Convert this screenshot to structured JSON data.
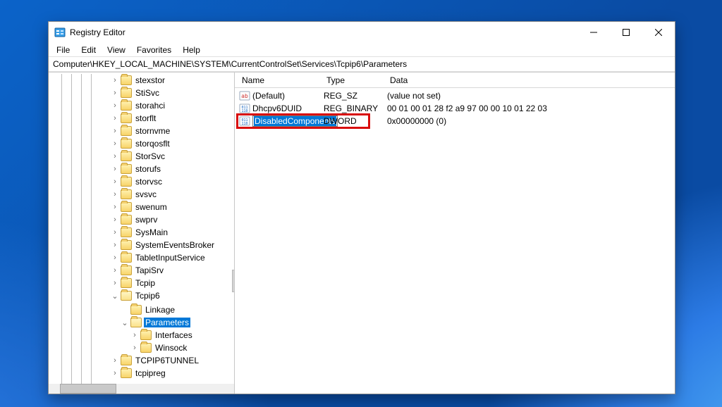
{
  "window": {
    "title": "Registry Editor",
    "menus": [
      "File",
      "Edit",
      "View",
      "Favorites",
      "Help"
    ],
    "address": "Computer\\HKEY_LOCAL_MACHINE\\SYSTEM\\CurrentControlSet\\Services\\Tcpip6\\Parameters"
  },
  "tree": [
    {
      "label": "stexstor",
      "depth": 0,
      "expander": ">"
    },
    {
      "label": "StiSvc",
      "depth": 0,
      "expander": ">"
    },
    {
      "label": "storahci",
      "depth": 0,
      "expander": ">"
    },
    {
      "label": "storflt",
      "depth": 0,
      "expander": ">"
    },
    {
      "label": "stornvme",
      "depth": 0,
      "expander": ">"
    },
    {
      "label": "storqosflt",
      "depth": 0,
      "expander": ">"
    },
    {
      "label": "StorSvc",
      "depth": 0,
      "expander": ">"
    },
    {
      "label": "storufs",
      "depth": 0,
      "expander": ">"
    },
    {
      "label": "storvsc",
      "depth": 0,
      "expander": ">"
    },
    {
      "label": "svsvc",
      "depth": 0,
      "expander": ">"
    },
    {
      "label": "swenum",
      "depth": 0,
      "expander": ">"
    },
    {
      "label": "swprv",
      "depth": 0,
      "expander": ">"
    },
    {
      "label": "SysMain",
      "depth": 0,
      "expander": ">"
    },
    {
      "label": "SystemEventsBroker",
      "depth": 0,
      "expander": ">"
    },
    {
      "label": "TabletInputService",
      "depth": 0,
      "expander": ">"
    },
    {
      "label": "TapiSrv",
      "depth": 0,
      "expander": ">"
    },
    {
      "label": "Tcpip",
      "depth": 0,
      "expander": ">"
    },
    {
      "label": "Tcpip6",
      "depth": 0,
      "expander": "v",
      "open": true
    },
    {
      "label": "Linkage",
      "depth": 1,
      "expander": ""
    },
    {
      "label": "Parameters",
      "depth": 1,
      "expander": "v",
      "open": true,
      "selected": true
    },
    {
      "label": "Interfaces",
      "depth": 2,
      "expander": ">"
    },
    {
      "label": "Winsock",
      "depth": 2,
      "expander": ">"
    },
    {
      "label": "TCPIP6TUNNEL",
      "depth": 0,
      "expander": ">"
    },
    {
      "label": "tcpipreg",
      "depth": 0,
      "expander": ">"
    }
  ],
  "columns": {
    "name": "Name",
    "type": "Type",
    "data": "Data"
  },
  "values": [
    {
      "icon": "str",
      "name": "(Default)",
      "type": "REG_SZ",
      "data": "(value not set)"
    },
    {
      "icon": "bin",
      "name": "Dhcpv6DUID",
      "type": "REG_BINARY",
      "data": "00 01 00 01 28 f2 a9 97 00 00 10 01 22 03"
    },
    {
      "icon": "bin",
      "name": "DisabledComponents",
      "type": "DWORD",
      "data": "0x00000000 (0)",
      "editing": true
    }
  ]
}
